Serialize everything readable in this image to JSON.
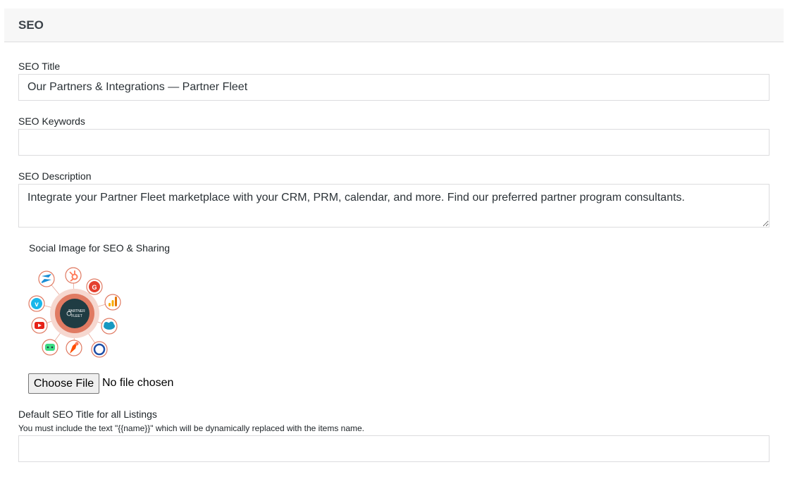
{
  "panel": {
    "title": "SEO"
  },
  "seo_title": {
    "label": "SEO Title",
    "value": "Our Partners & Integrations — Partner Fleet"
  },
  "seo_keywords": {
    "label": "SEO Keywords",
    "value": ""
  },
  "seo_description": {
    "label": "SEO Description",
    "value": "Integrate your Partner Fleet marketplace with your CRM, PRM, calendar, and more. Find our preferred partner program consultants."
  },
  "social_image": {
    "label": "Social Image for SEO & Sharing",
    "logo_text_line1": "PARTNER",
    "logo_text_line2": "FLEET",
    "icons": [
      "zendesk-icon",
      "hubspot-icon",
      "g2-icon",
      "google-analytics-icon",
      "salesforce-icon",
      "calendly-icon",
      "zapier-icon",
      "android-icon",
      "youtube-icon",
      "vimeo-icon"
    ],
    "colors": {
      "ring": "#e07a62",
      "hub": "#1f3c43",
      "halo": "#f6d7cf"
    }
  },
  "file_input": {
    "button_label": "Choose File",
    "status": "No file chosen"
  },
  "default_listing_title": {
    "label": "Default SEO Title for all Listings",
    "help": "You must include the text \"{{name}}\" which will be dynamically replaced with the items name.",
    "value": ""
  }
}
